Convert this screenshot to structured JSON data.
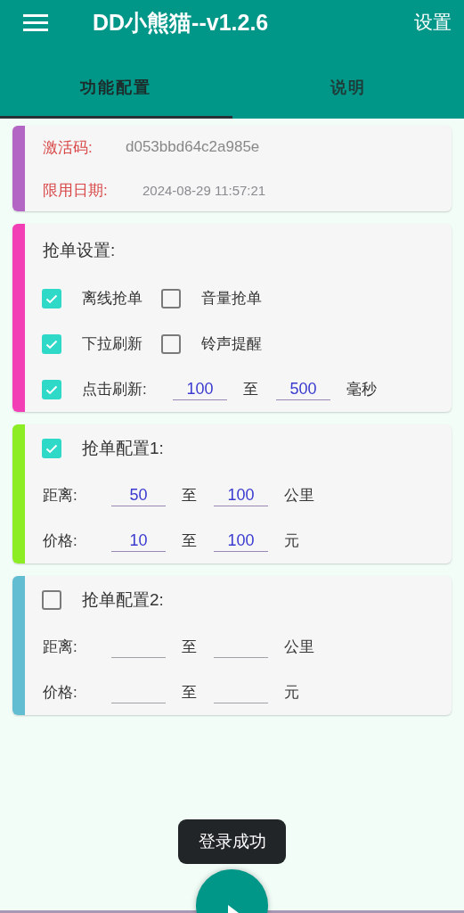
{
  "app_bar": {
    "title": "DD小熊猫--v1.2.6",
    "action": "设置"
  },
  "tabs": [
    {
      "label": "功能配置",
      "selected": true
    },
    {
      "label": "说明",
      "selected": false
    }
  ],
  "activation": {
    "color": "#b466c4",
    "rows": [
      {
        "label": "激活码:",
        "value": "d053bbd64c2a985e"
      },
      {
        "label": "限用日期:",
        "value": "2024-08-29 11:57:21"
      }
    ]
  },
  "grab_settings": {
    "color": "#f23fb6",
    "title": "抢单设置:",
    "rows": [
      {
        "kind": "checks",
        "items": [
          {
            "label": "离线抢单",
            "checked": true
          },
          {
            "label": "音量抢单",
            "checked": false
          }
        ]
      },
      {
        "kind": "checks",
        "items": [
          {
            "label": "下拉刷新",
            "checked": true
          },
          {
            "label": "铃声提醒",
            "checked": false
          }
        ]
      },
      {
        "kind": "range",
        "checked": true,
        "label": "点击刷新:",
        "from": "100",
        "sep": "至",
        "to": "500",
        "unit": "毫秒"
      }
    ]
  },
  "configs": [
    {
      "color": "#8ced25",
      "checked": true,
      "title": "抢单配置1:",
      "ranges": [
        {
          "label": "距离:",
          "from": "50",
          "sep": "至",
          "to": "100",
          "unit": "公里"
        },
        {
          "label": "价格:",
          "from": "10",
          "sep": "至",
          "to": "100",
          "unit": "元"
        }
      ]
    },
    {
      "color": "#62bcd2",
      "checked": false,
      "title": "抢单配置2:",
      "ranges": [
        {
          "label": "距离:",
          "sep": "至",
          "unit": "公里"
        },
        {
          "label": "价格:",
          "sep": "至",
          "unit": "元"
        }
      ]
    }
  ],
  "toast": "登录成功"
}
